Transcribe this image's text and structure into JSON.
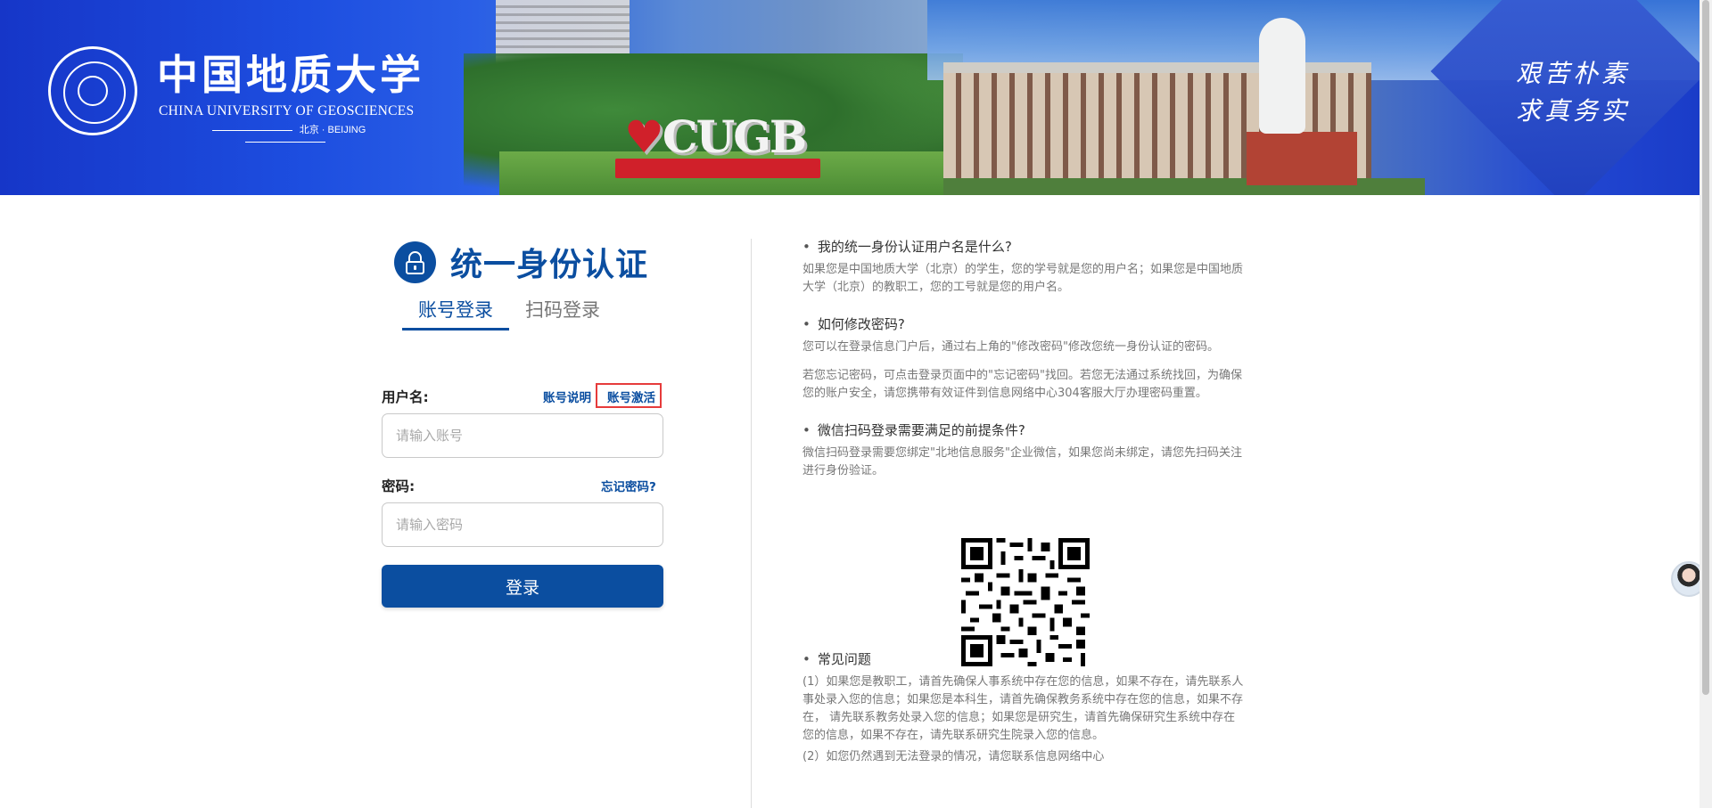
{
  "banner": {
    "logo_cn": "中国地质大学",
    "logo_en": "CHINA UNIVERSITY OF GEOSCIENCES",
    "logo_city": "北京 · BEIJING",
    "sign_text": "CUGB",
    "motto_line1": "艰苦朴素",
    "motto_line2": "求真务实"
  },
  "login": {
    "title": "统一身份认证",
    "tabs": [
      {
        "label": "账号登录",
        "active": true
      },
      {
        "label": "扫码登录",
        "active": false
      }
    ],
    "username_label": "用户名:",
    "account_help_link": "账号说明",
    "account_activate_link": "账号激活",
    "username_placeholder": "请输入账号",
    "password_label": "密码:",
    "forgot_password_link": "忘记密码?",
    "password_placeholder": "请输入密码",
    "submit_label": "登录"
  },
  "faq": [
    {
      "q": "我的统一身份认证用户名是什么?",
      "a": [
        "如果您是中国地质大学（北京）的学生，您的学号就是您的用户名；如果您是中国地质大学（北京）的教职工，您的工号就是您的用户名。"
      ]
    },
    {
      "q": "如何修改密码?",
      "a": [
        "您可以在登录信息门户后，通过右上角的\"修改密码\"修改您统一身份认证的密码。",
        "若您忘记密码，可点击登录页面中的\"忘记密码\"找回。若您无法通过系统找回，为确保您的账户安全，请您携带有效证件到信息网络中心304客服大厅办理密码重置。"
      ]
    },
    {
      "q": "微信扫码登录需要满足的前提条件?",
      "a": [
        "微信扫码登录需要您绑定\"北地信息服务\"企业微信，如果您尚未绑定，请您先扫码关注进行身份验证。"
      ]
    },
    {
      "q": "常见问题",
      "a": [
        "(1）如果您是教职工，请首先确保人事系统中存在您的信息，如果不存在，请先联系人事处录入您的信息；如果您是本科生，请首先确保教务系统中存在您的信息，如果不存在， 请先联系教务处录入您的信息；如果您是研究生，请首先确保研究生系统中存在您的信息，如果不存在，请先联系研究生院录入您的信息。",
        "(2）如您仍然遇到无法登录的情况，请您联系信息网络中心"
      ]
    }
  ],
  "colors": {
    "brand_blue": "#0b4ea0",
    "highlight_red": "#e63b3b"
  },
  "icons": {
    "lock": "lock-icon",
    "qr": "qr-code",
    "assistant": "assistant-avatar-icon"
  }
}
